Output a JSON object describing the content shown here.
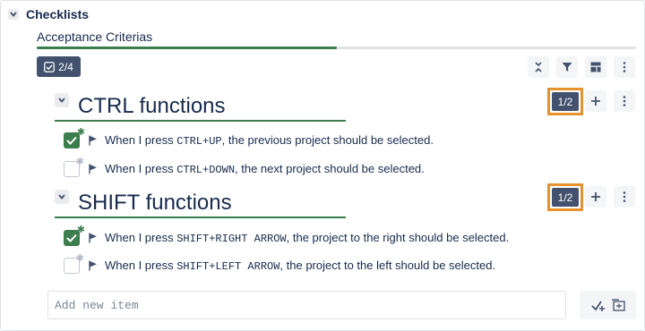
{
  "section": {
    "title": "Checklists"
  },
  "checklist": {
    "name": "Acceptance Criterias",
    "progress_fraction": 0.5,
    "count_label": "2/4"
  },
  "groups": [
    {
      "title": "CTRL functions",
      "badge": "1/2",
      "items": [
        {
          "checked": true,
          "prefix": "When I press ",
          "key": "CTRL+UP",
          "suffix": ", the previous project should be selected."
        },
        {
          "checked": false,
          "prefix": "When I press ",
          "key": "CTRL+DOWN",
          "suffix": ", the next project should be selected."
        }
      ]
    },
    {
      "title": "SHIFT functions",
      "badge": "1/2",
      "items": [
        {
          "checked": true,
          "prefix": "When I press ",
          "key": "SHIFT+RIGHT ARROW",
          "suffix": ", the project to the right should be selected."
        },
        {
          "checked": false,
          "prefix": "When I press ",
          "key": "SHIFT+LEFT ARROW",
          "suffix": ", the project to the left should be selected."
        }
      ]
    }
  ],
  "add_item": {
    "placeholder": "Add new item"
  },
  "icons": {
    "section_toggle": "chevron-down-icon",
    "badge": "checkbox-icon",
    "toolbar": [
      "collapse-all-icon",
      "filter-icon",
      "layout-icon",
      "more-icon"
    ],
    "group_actions": [
      "plus-icon",
      "more-icon"
    ],
    "add_buttons": [
      "add-check-icon",
      "add-to-list-icon"
    ]
  },
  "colors": {
    "accent_green": "#3c7d4e",
    "badge_bg": "#42526e",
    "highlight_orange": "#e8912d"
  }
}
